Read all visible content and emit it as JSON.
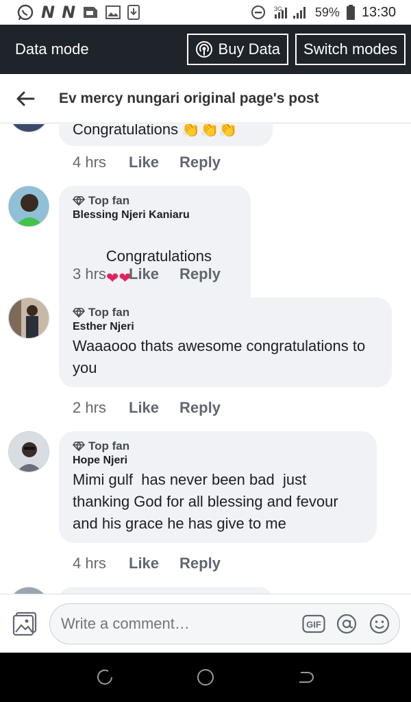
{
  "status_bar": {
    "battery": "59%",
    "time": "13:30",
    "network": "3G",
    "icons": [
      "whatsapp-icon",
      "n-icon",
      "n-icon",
      "sim-icon",
      "gallery-icon",
      "download-icon",
      "dnd-icon",
      "signal-icon",
      "battery-icon"
    ]
  },
  "data_bar": {
    "title": "Data mode",
    "buy_label": "Buy Data",
    "switch_label": "Switch modes"
  },
  "header": {
    "title": "Ev mercy nungari original page's post"
  },
  "comments": [
    {
      "text": "Congratulations",
      "emoji": "👏👏👏",
      "time": "4 hrs",
      "like": "Like",
      "reply": "Reply"
    },
    {
      "badge": "Top fan",
      "author": "Blessing Njeri Kaniaru",
      "text": "Congratulations",
      "emoji": "❤❤",
      "time": "3 hrs",
      "like": "Like",
      "reply": "Reply"
    },
    {
      "badge": "Top fan",
      "author": "Esther Njeri",
      "text": "Waaaooo thats awesome congratulations to you",
      "time": "2 hrs",
      "like": "Like",
      "reply": "Reply"
    },
    {
      "badge": "Top fan",
      "author": "Hope Njeri",
      "text": "Mimi gulf  has never been bad  just thanking God for all blessing and fevour and his grace he has give to me",
      "time": "4 hrs",
      "like": "Like",
      "reply": "Reply"
    }
  ],
  "composer": {
    "placeholder": "Write a comment…",
    "gif_label": "GIF"
  },
  "colors": {
    "data_bar_bg": "#1f232a",
    "bubble_bg": "#f0f2f5",
    "heart": "#e0245e"
  }
}
